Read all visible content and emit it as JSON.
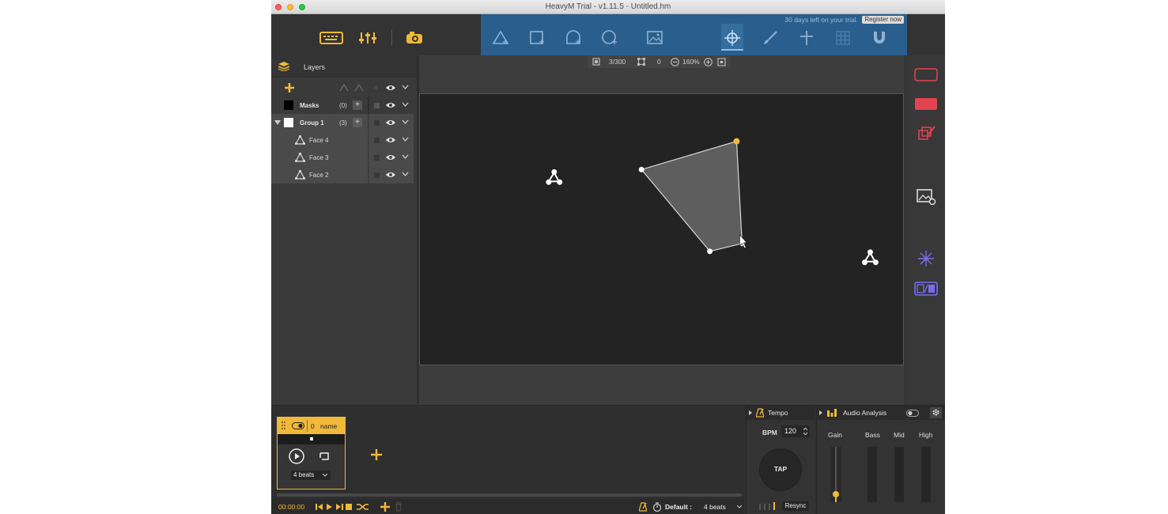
{
  "window": {
    "title": "HeavyM Trial - v1.11.5 - Untitled.hm"
  },
  "trial": {
    "days_left": "30 days left on your trial.",
    "register": "Register now"
  },
  "colors": {
    "accent": "#f0b93a",
    "tools_bg": "#2a5f8d",
    "red": "#e0434f",
    "purple": "#7b6cf0",
    "canvas": "#232323"
  },
  "toolbar": {
    "left_icons": [
      "keyboard-icon",
      "sliders-icon",
      "projector-icon"
    ],
    "draw_tools": [
      "triangle-tool-icon",
      "square-tool-icon",
      "bell-tool-icon",
      "circle-tool-icon",
      "image-tool-icon"
    ],
    "edit_tools": [
      "select-tool-icon",
      "brush-tool-icon",
      "cross-tool-icon",
      "grid-tool-icon",
      "magnet-tool-icon"
    ]
  },
  "zoom": {
    "faces": "3/300",
    "count": "0",
    "zoom": "160%"
  },
  "layers": {
    "title": "Layers",
    "rows": [
      {
        "label": "Masks",
        "count": "(0)"
      },
      {
        "label": "Group 1",
        "count": "(3)"
      },
      {
        "label": "Face 4"
      },
      {
        "label": "Face 3"
      },
      {
        "label": "Face 2"
      }
    ]
  },
  "clip": {
    "index": "0",
    "name": "name",
    "beats": "4 beats"
  },
  "transport": {
    "time": "00:00:00",
    "default_label": "Default :",
    "beats": "4 beats"
  },
  "tempo": {
    "title": "Tempo",
    "bpm_label": "BPM",
    "bpm": "120",
    "tap": "TAP",
    "resync": "Resync"
  },
  "audio": {
    "title": "Audio Analysis",
    "gain": "Gain",
    "bass": "Bass",
    "mid": "Mid",
    "high": "High",
    "gain_level": 0.15
  }
}
